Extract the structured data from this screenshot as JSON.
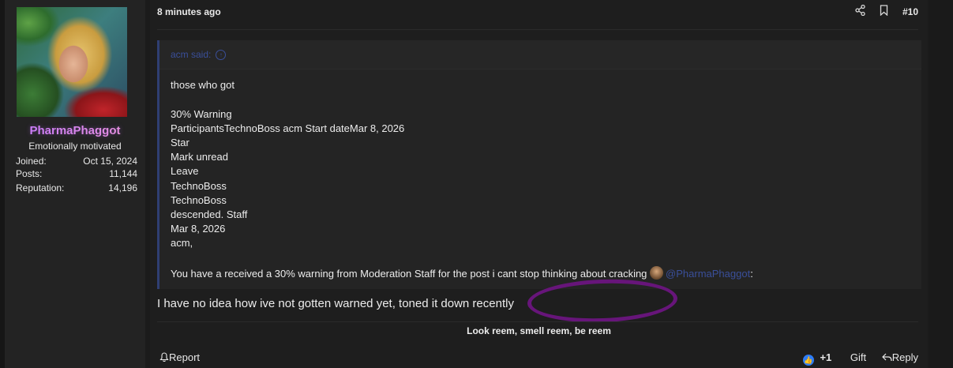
{
  "user": {
    "name": "PharmaPhaggot",
    "title": "Emotionally motivated",
    "stats": [
      {
        "label": "Joined:",
        "value": "Oct 15, 2024"
      },
      {
        "label": "Posts:",
        "value": "11,144"
      },
      {
        "label": "Reputation:",
        "value": "14,196"
      }
    ]
  },
  "post": {
    "time": "8 minutes ago",
    "number": "#10",
    "quote": {
      "author": "acm said:",
      "lines": [
        "those who got",
        "",
        "30% Warning",
        "ParticipantsTechnoBoss acm Start dateMar 8, 2026",
        "Star",
        "Mark unread",
        "Leave",
        "TechnoBoss",
        "TechnoBoss",
        "descended. Staff",
        "Mar 8, 2026",
        "acm,",
        ""
      ],
      "last_line_prefix": "You have a received a 30% warning from Moderation Staff for the post i cant stop thinking about cracking ",
      "mention": "@PharmaPhaggot",
      "last_line_suffix": ":"
    },
    "body": "I have no idea how ive not gotten warned yet, toned it down recently",
    "signature": "Look reem, smell reem, be reem"
  },
  "footer": {
    "report": "Report",
    "reaction_count": "+1",
    "gift": "Gift",
    "reply": "Reply"
  },
  "icons": [
    "share-icon",
    "bookmark-icon",
    "arrow-up-circle-icon",
    "bell-icon",
    "like-reaction-icon",
    "reply-arrow-icon"
  ],
  "colors": {
    "username_gradient_start": "#c77bff",
    "username_gradient_end": "#f59bd6",
    "quote_accent": "#2f3f73",
    "mention": "#3a4f9a",
    "annotation_circle": "#6b1580"
  }
}
